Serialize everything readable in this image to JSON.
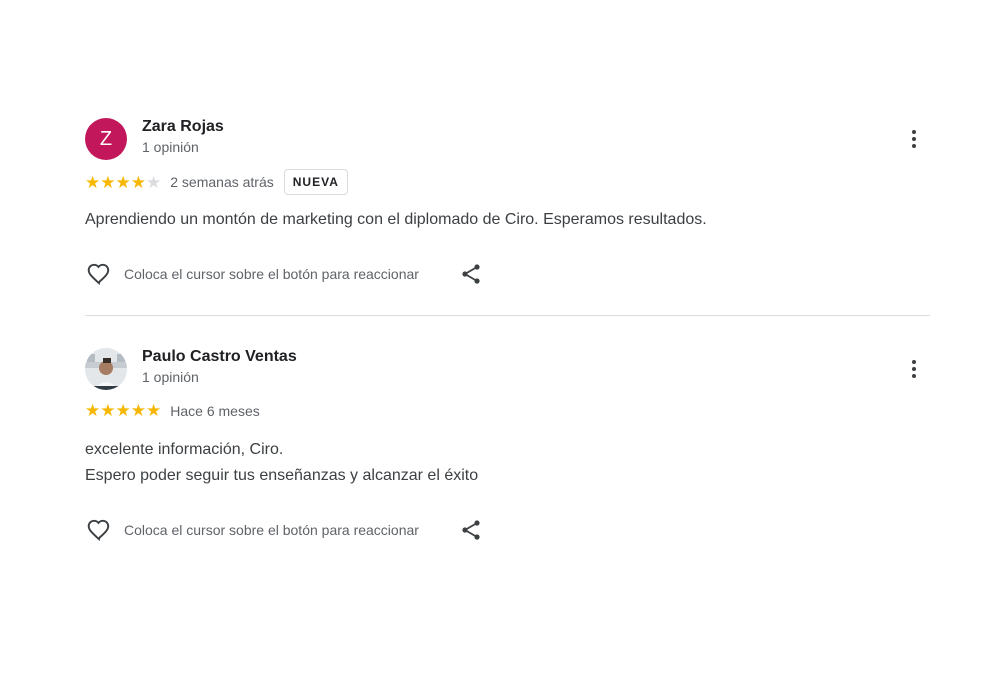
{
  "reviews": [
    {
      "initial": "Z",
      "avatar_color": "#c2185b",
      "name": "Zara Rojas",
      "subtitle": "1 opinión",
      "rating": 4,
      "max_rating": 5,
      "date": "2 semanas atrás",
      "badge": "NUEVA",
      "text": "Aprendiendo un montón de marketing con el diplomado de Ciro. Esperamos resultados.",
      "react_label": "Coloca el cursor sobre el botón para reaccionar"
    },
    {
      "avatar": "photo",
      "name": "Paulo Castro Ventas",
      "subtitle": "1 opinión",
      "rating": 5,
      "max_rating": 5,
      "date": "Hace 6 meses",
      "text_line1": "excelente información, Ciro.",
      "text_line2": "Espero poder seguir tus enseñanzas y alcanzar el éxito",
      "react_label": "Coloca el cursor sobre el botón para reaccionar"
    }
  ],
  "colors": {
    "star_filled": "#f6b805",
    "star_empty": "#dadce0",
    "divider": "#dadce0"
  },
  "icons": [
    "more-vert-icon",
    "star-icon",
    "heart-outline-icon",
    "share-icon"
  ]
}
